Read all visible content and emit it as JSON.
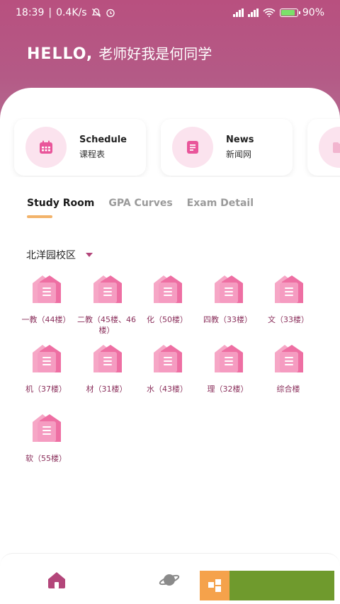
{
  "status_bar": {
    "time": "18:39",
    "speed": "0.4K/s",
    "battery": "90%"
  },
  "header": {
    "greeting": "HELLO,",
    "name": "老师好我是何同学"
  },
  "quick_cards": [
    {
      "title": "Schedule",
      "subtitle": "课程表",
      "icon": "calendar-icon"
    },
    {
      "title": "News",
      "subtitle": "新闻网",
      "icon": "document-icon"
    },
    {
      "title": "",
      "subtitle": "",
      "icon": "folder-icon"
    }
  ],
  "tabs": [
    "Study Room",
    "GPA Curves",
    "Exam Detail"
  ],
  "campus": {
    "label": "北洋园校区"
  },
  "buildings": [
    "一教（44楼）",
    "二教（45楼、46楼）",
    "化（50楼）",
    "四教（33楼）",
    "文（33楼）",
    "机（37楼）",
    "材（31楼）",
    "水（43楼）",
    "理（32楼）",
    "综合楼",
    "软（55楼）"
  ],
  "colors": {
    "header": "#b8507f",
    "accent": "#b3467a",
    "tab_underline": "#f2b36a",
    "card_icon_bg": "#fbe3ee"
  }
}
